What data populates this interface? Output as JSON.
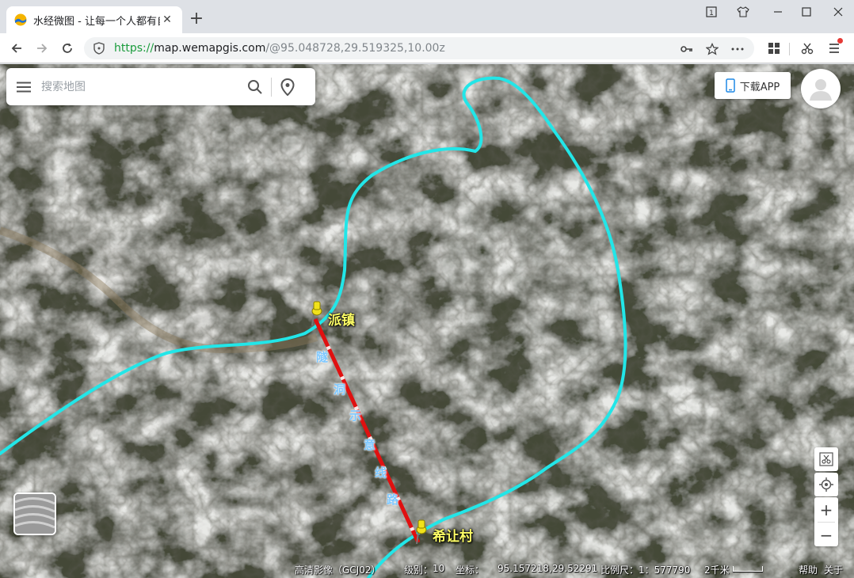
{
  "browser": {
    "tab_title": "水经微图 - 让每一个人都有自",
    "url_scheme": "https://",
    "url_host": "map.wemapgis.com",
    "url_path": "/@95.048728,29.519325,10.00z"
  },
  "search": {
    "placeholder": "搜索地图"
  },
  "header": {
    "download_label": "下载APP"
  },
  "map_labels": {
    "place_pai": "派镇",
    "place_xirang": "希让村",
    "tunnel": [
      "隧",
      "洞",
      "示",
      "意",
      "线",
      "路"
    ]
  },
  "zoom": {
    "in": "+",
    "out": "−"
  },
  "status": {
    "layer": "高清影像（GCJ02）",
    "level_label": "级别：",
    "level": "10",
    "coord_label": "坐标：",
    "lon": "95.157218,",
    "lat": "29.52291",
    "scale_label": "比例尺：",
    "scale": "1：577790",
    "distance": "2千米",
    "help": "帮助",
    "about": "关于"
  },
  "colors": {
    "route": "#22e6e8",
    "tunnel": "#e01010",
    "place_label": "#ffff66"
  },
  "icons": {
    "tab": "wemap-favicon",
    "menu": "hamburger-icon",
    "search": "search-icon",
    "location": "location-pin-icon",
    "avatar": "user-icon"
  }
}
